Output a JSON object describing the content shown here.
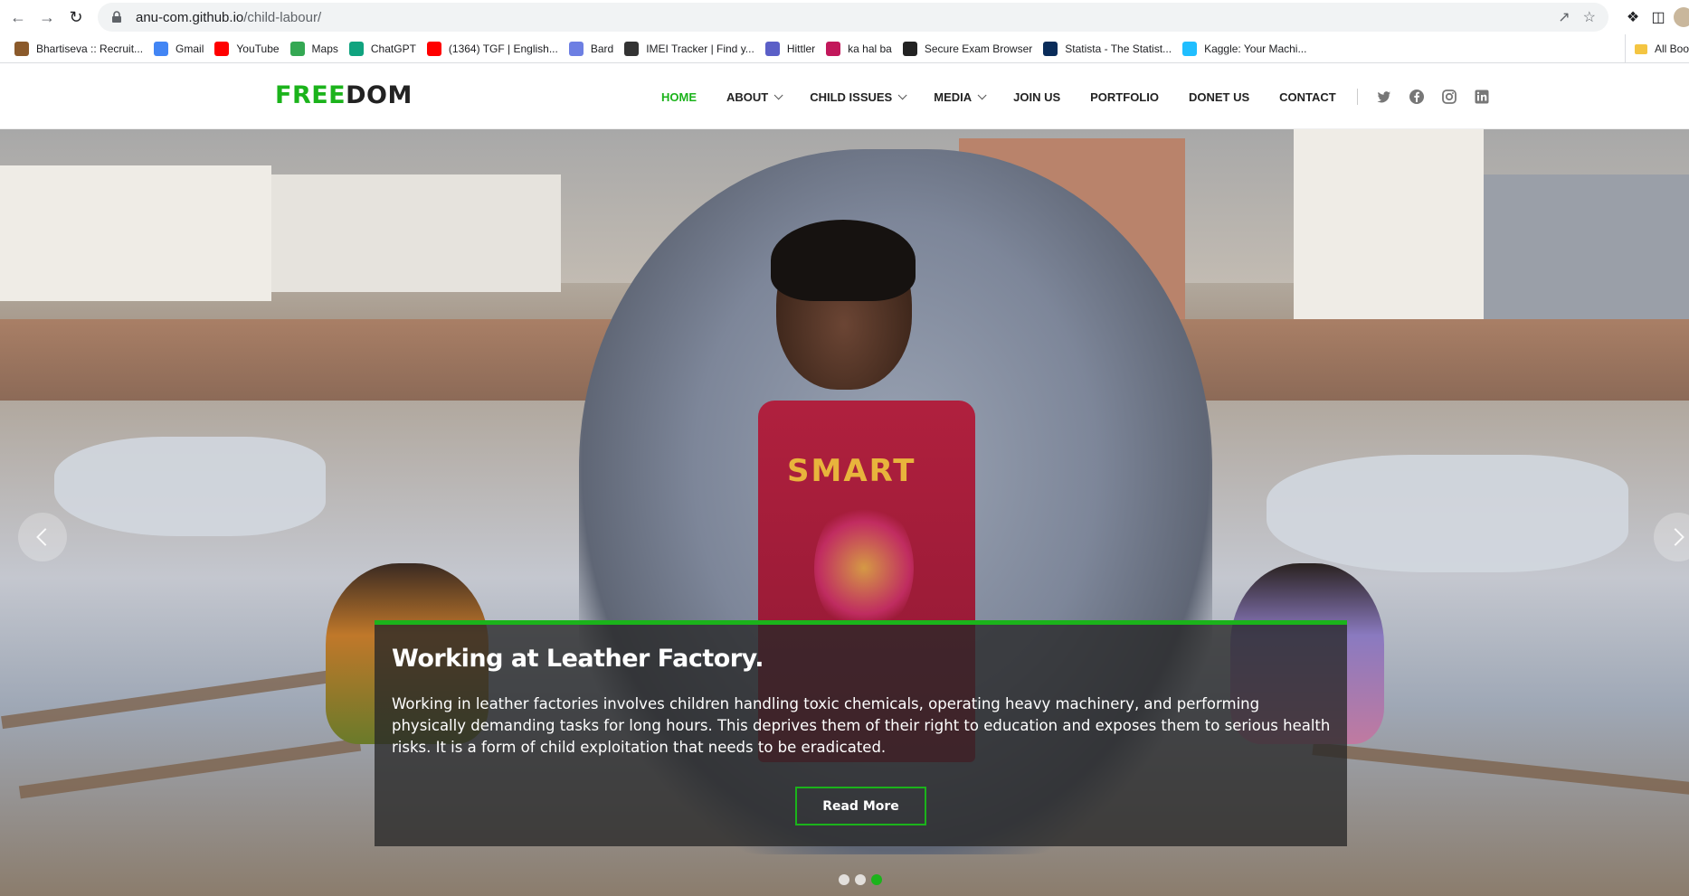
{
  "browser": {
    "url_host": "anu-com.github.io",
    "url_path": "/child-labour/",
    "bookmarks": [
      {
        "label": "Bhartiseva :: Recruit...",
        "icon": "star-logo-icon",
        "color": "#8b5a2b"
      },
      {
        "label": "Gmail",
        "icon": "google-icon",
        "color": "#4285f4"
      },
      {
        "label": "YouTube",
        "icon": "youtube-icon",
        "color": "#ff0000"
      },
      {
        "label": "Maps",
        "icon": "maps-pin-icon",
        "color": "#34a853"
      },
      {
        "label": "ChatGPT",
        "icon": "chatgpt-icon",
        "color": "#10a37f"
      },
      {
        "label": "(1364) TGF | English...",
        "icon": "youtube-icon",
        "color": "#ff0000"
      },
      {
        "label": "Bard",
        "icon": "bard-sparkle-icon",
        "color": "#6d7fe3"
      },
      {
        "label": "IMEI Tracker | Find y...",
        "icon": "imei-icon",
        "color": "#333333"
      },
      {
        "label": "Hittler",
        "icon": "teams-icon",
        "color": "#5b5fc7"
      },
      {
        "label": "ka hal ba",
        "icon": "t-logo-icon",
        "color": "#c2185b"
      },
      {
        "label": "Secure Exam Browser",
        "icon": "seb-icon",
        "color": "#222222"
      },
      {
        "label": "Statista - The Statist...",
        "icon": "statista-icon",
        "color": "#0a2c5a"
      },
      {
        "label": "Kaggle: Your Machi...",
        "icon": "kaggle-icon",
        "color": "#20beff"
      }
    ],
    "all_bookmarks": "All Boo"
  },
  "site": {
    "logo_part1": "FREE",
    "logo_part2": "DOM",
    "nav": [
      {
        "label": "HOME",
        "active": true,
        "dropdown": false
      },
      {
        "label": "ABOUT",
        "active": false,
        "dropdown": true
      },
      {
        "label": "CHILD ISSUES",
        "active": false,
        "dropdown": true
      },
      {
        "label": "MEDIA",
        "active": false,
        "dropdown": true
      },
      {
        "label": "JOIN US",
        "active": false,
        "dropdown": false
      },
      {
        "label": "PORTFOLIO",
        "active": false,
        "dropdown": false
      },
      {
        "label": "DONET US",
        "active": false,
        "dropdown": false
      },
      {
        "label": "CONTACT",
        "active": false,
        "dropdown": false
      }
    ],
    "social": [
      "twitter-icon",
      "facebook-icon",
      "instagram-icon",
      "linkedin-icon"
    ],
    "accent_color": "#1bb31b"
  },
  "hero": {
    "shirt_text": "SMART",
    "title": "Working at Leather Factory.",
    "text": "Working in leather factories involves children handling toxic chemicals, operating heavy machinery, and performing physically demanding tasks for long hours. This deprives them of their right to education and exposes them to serious health risks. It is a form of child exploitation that needs to be eradicated.",
    "button": "Read More",
    "slides": 3,
    "active_slide": 3
  }
}
